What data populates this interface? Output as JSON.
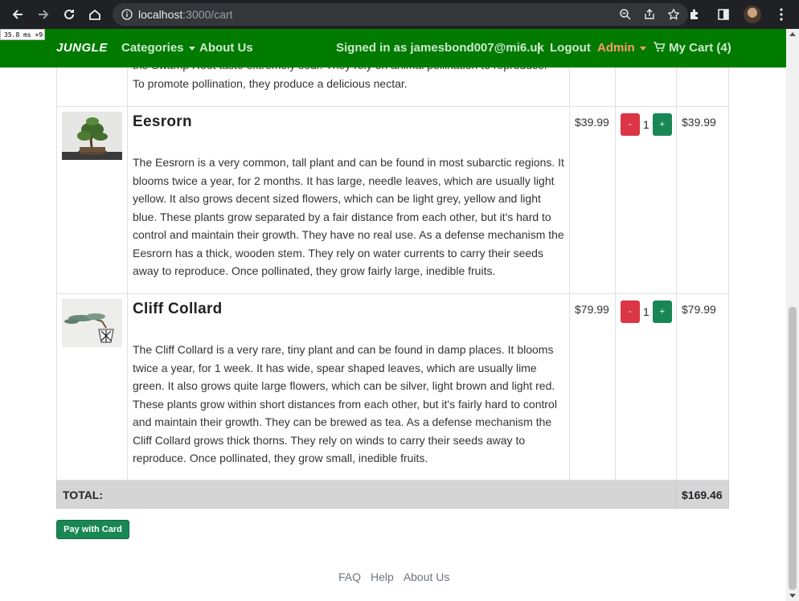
{
  "browser": {
    "url_host": "localhost",
    "url_path": ":3000/cart"
  },
  "perf_badge": "35.8 ms ×9",
  "navbar": {
    "brand": "JUNGLE",
    "categories": "Categories",
    "about": "About Us",
    "signed_in": "Signed in as jamesbond007@mi6.uk",
    "separator": "|",
    "logout": "Logout",
    "admin": "Admin",
    "cart": "My Cart (4)"
  },
  "cart": {
    "partial_row": {
      "text_line1": "the Swamp Root taste extremely sour. They rely on animal pollination to reproduce.",
      "text_line2": "To promote pollination, they produce a delicious nectar."
    },
    "items": [
      {
        "name": "Eesrorn",
        "description": "The Eesrorn is a very common, tall plant and can be found in most subarctic regions. It blooms twice a year, for 2 months. It has large, needle leaves, which are usually light yellow. It also grows decent sized flowers, which can be light grey, yellow and light blue. These plants grow separated by a fair distance from each other, but it's hard to control and maintain their growth. They have no real use. As a defense mechanism the Eesrorn has a thick, wooden stem. They rely on water currents to carry their seeds away to reproduce. Once pollinated, they grow fairly large, inedible fruits.",
        "price": "$39.99",
        "qty": "1",
        "minus": "-",
        "plus": "+",
        "total": "$39.99"
      },
      {
        "name": "Cliff Collard",
        "description": "The Cliff Collard is a very rare, tiny plant and can be found in damp places. It blooms twice a year, for 1 week. It has wide, spear shaped leaves, which are usually lime green. It also grows quite large flowers, which can be silver, light brown and light red. These plants grow within short distances from each other, but it's fairly hard to control and maintain their growth. They can be brewed as tea. As a defense mechanism the Cliff Collard grows thick thorns. They rely on winds to carry their seeds away to reproduce. Once pollinated, they grow small, inedible fruits.",
        "price": "$79.99",
        "qty": "1",
        "minus": "-",
        "plus": "+",
        "total": "$79.99"
      }
    ],
    "total_label": "TOTAL:",
    "total_value": "$169.46"
  },
  "pay_button": "Pay with Card",
  "footer": {
    "faq": "FAQ",
    "help": "Help",
    "about": "About Us"
  },
  "colors": {
    "navbar_bg": "#007b00",
    "admin_link": "#ff9a6b",
    "minus_btn": "#dc3545",
    "plus_btn": "#198754"
  }
}
